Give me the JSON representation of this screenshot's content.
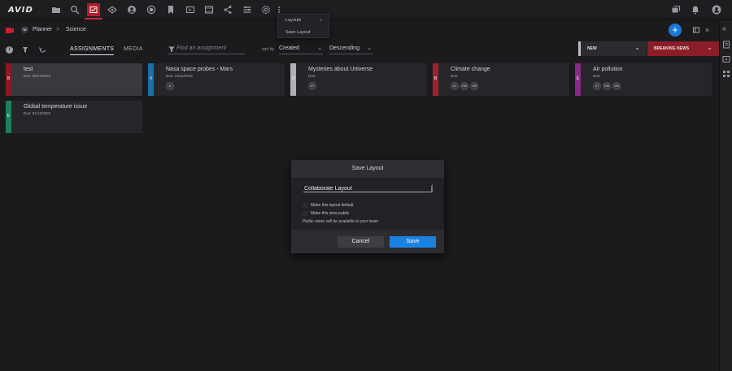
{
  "app": {
    "logo": "AVID"
  },
  "topbar": {
    "icons": [
      "folder-icon",
      "search-icon",
      "planner-icon",
      "binoculars-icon",
      "headphones-icon",
      "record-icon",
      "bookmark-icon",
      "media-icon",
      "share-icon",
      "layout-icon",
      "settings-icon",
      "more-icon"
    ],
    "active_icon": "planner-icon",
    "right_icons": [
      "windows-icon",
      "bell-icon",
      "user-icon"
    ]
  },
  "layouts_menu": {
    "items": [
      {
        "label": "Layouts",
        "has_submenu": true
      },
      {
        "label": "Save Layout"
      }
    ]
  },
  "breadcrumb": {
    "root": "Planner",
    "separator": ">",
    "current": "Science"
  },
  "tabs": [
    {
      "label": "ASSIGNMENTS",
      "active": true
    },
    {
      "label": "MEDIA",
      "active": false
    }
  ],
  "search": {
    "placeholder": "Find an assignment"
  },
  "sort": {
    "label": "sort by",
    "field": "Created",
    "order": "Descending"
  },
  "columns": [
    {
      "title": "NEW",
      "color": "#bdbdbd"
    },
    {
      "title": "BREAKING NEWS",
      "color": "#8c1d27"
    }
  ],
  "cards": [
    {
      "title": "test",
      "due": "Due: 08/12/2022",
      "tag": "B",
      "color": "#8b1a24",
      "avatars": [],
      "highlighted": true
    },
    {
      "title": "Nasa space probes - Mars",
      "due": "Due: 23/11/2022",
      "tag": "V",
      "color": "#1b6fa8",
      "avatars": [
        "A"
      ],
      "highlighted": false
    },
    {
      "title": "Mysteries about Universe",
      "due": "Due:",
      "tag": "V",
      "color": "#b0b0b0",
      "avatars": [
        "AT"
      ],
      "highlighted": false
    },
    {
      "title": "Climate change",
      "due": "Due:",
      "tag": "B",
      "color": "#a0222e",
      "avatars": [
        "AT",
        "DM",
        "VM"
      ],
      "highlighted": false
    },
    {
      "title": "Air pollution",
      "due": "Due:",
      "tag": "E",
      "color": "#8a2a86",
      "avatars": [
        "AT",
        "DM",
        "VM"
      ],
      "highlighted": false
    },
    {
      "title": "Global temperature issue",
      "due": "Due: 01/12/2022",
      "tag": "E",
      "color": "#1e7f5f",
      "avatars": [],
      "highlighted": false
    }
  ],
  "modal": {
    "title": "Save Layout",
    "input_value": "Collaborate Layout",
    "option_default": "Make this layout default",
    "option_public": "Make this view public",
    "note": "Public views will be available to your team",
    "cancel_label": "Cancel",
    "save_label": "Save"
  }
}
